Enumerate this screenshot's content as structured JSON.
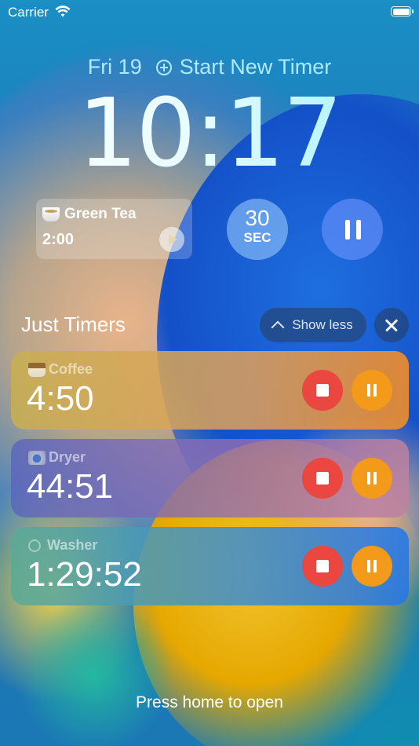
{
  "status_bar": {
    "carrier": "Carrier",
    "wifi_icon": "wifi-icon",
    "battery_icon": "battery-icon"
  },
  "header": {
    "date": "Fri 19",
    "action_icon": "plus-circle-icon",
    "action_label": "Start New Timer",
    "time": "10:17",
    "accent_color": "#aeeafe"
  },
  "widgets": {
    "quick_timer": {
      "label": "Green Tea",
      "icon": "tea-cup-icon",
      "duration": "2:00",
      "play_icon": "play-icon"
    },
    "interval": {
      "value": "30",
      "unit": "SEC"
    },
    "pause_icon": "pause-icon"
  },
  "section": {
    "title": "Just Timers",
    "show_less_label": "Show less",
    "chevron_icon": "chevron-up-icon",
    "close_icon": "close-icon"
  },
  "timers": [
    {
      "label": "Coffee",
      "icon": "coffee-icon",
      "time": "4:50"
    },
    {
      "label": "Dryer",
      "icon": "dryer-icon",
      "time": "44:51"
    },
    {
      "label": "Washer",
      "icon": "washer-icon",
      "time": "1:29:52"
    }
  ],
  "colors": {
    "stop": "#e9473f",
    "pause": "#f39a1a"
  },
  "footer": {
    "hint": "Press home to open"
  }
}
